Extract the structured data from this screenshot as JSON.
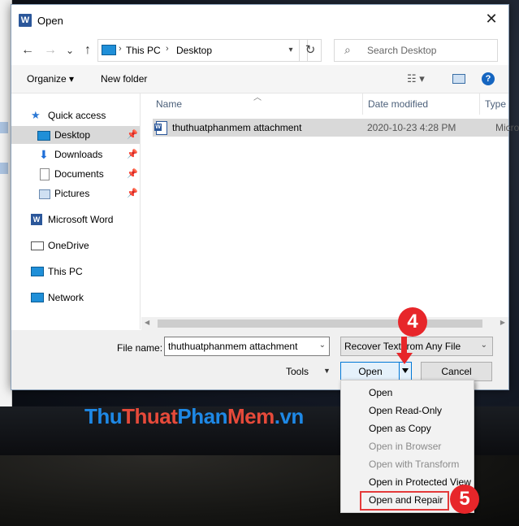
{
  "window": {
    "title": "Open",
    "app_icon": "word-icon",
    "close_glyph": "✕"
  },
  "nav": {
    "back_glyph": "←",
    "forward_glyph": "→",
    "recent_glyph": "⌄",
    "up_glyph": "↑",
    "address": [
      "This PC",
      "Desktop"
    ],
    "refresh_glyph": "↻",
    "search_placeholder": "Search Desktop"
  },
  "toolbar": {
    "organize": "Organize ▾",
    "new_folder": "New folder",
    "view_glyph": "☷ ▾",
    "help": "?"
  },
  "sidebar": {
    "items": [
      {
        "label": "Quick access",
        "icon": "star-icon"
      },
      {
        "label": "Desktop",
        "icon": "desktop-icon",
        "pinned": true,
        "selected": true
      },
      {
        "label": "Downloads",
        "icon": "download-icon",
        "pinned": true
      },
      {
        "label": "Documents",
        "icon": "document-icon",
        "pinned": true
      },
      {
        "label": "Pictures",
        "icon": "picture-icon",
        "pinned": true
      },
      {
        "label": "Microsoft Word",
        "icon": "word-icon"
      },
      {
        "label": "OneDrive",
        "icon": "cloud-icon"
      },
      {
        "label": "This PC",
        "icon": "computer-icon"
      },
      {
        "label": "Network",
        "icon": "network-icon"
      }
    ]
  },
  "columns": {
    "name": "Name",
    "date": "Date modified",
    "type": "Type"
  },
  "files": [
    {
      "name": "thuthuatphanmem attachment",
      "date": "2020-10-23 4:28 PM",
      "type": "Micro"
    }
  ],
  "bottom": {
    "file_name_label": "File name:",
    "file_name_value": "thuthuatphanmem attachment",
    "file_type_value": "Recover Text from Any File",
    "tools": "Tools",
    "open": "Open",
    "cancel": "Cancel"
  },
  "open_menu": {
    "items": [
      {
        "label": "Open",
        "disabled": false
      },
      {
        "label": "Open Read-Only",
        "disabled": false
      },
      {
        "label": "Open as Copy",
        "disabled": false
      },
      {
        "label": "Open in Browser",
        "disabled": true
      },
      {
        "label": "Open with Transform",
        "disabled": true
      },
      {
        "label": "Open in Protected View",
        "disabled": false
      },
      {
        "label": "Open and Repair",
        "disabled": false,
        "highlighted": true
      }
    ]
  },
  "annotations": {
    "step4": "4",
    "step5": "5",
    "accent": "#e7262a"
  },
  "watermark": {
    "parts": [
      "Thu",
      "Thuat",
      "Phan",
      "Mem",
      ".vn"
    ]
  }
}
